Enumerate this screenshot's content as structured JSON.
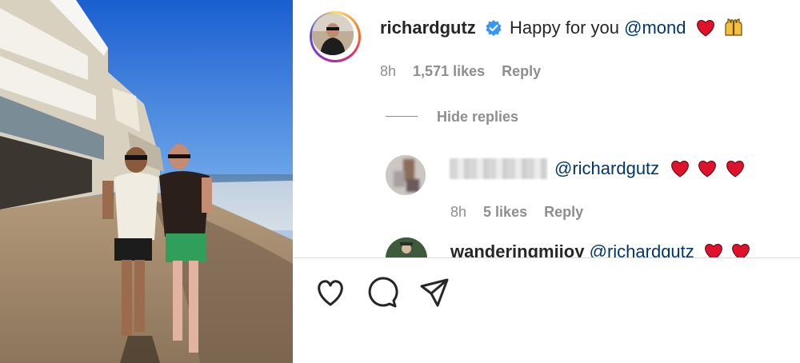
{
  "post": {
    "image_icon": "beach-photo"
  },
  "comment": {
    "username": "richardgutz",
    "verified_icon": "verified-badge-icon",
    "text": "Happy for you",
    "mention": "@mond",
    "emojis": [
      "red-heart",
      "raising-hands"
    ],
    "time": "8h",
    "likes": "1,571 likes",
    "reply_label": "Reply"
  },
  "replies_toggle": "Hide replies",
  "replies": [
    {
      "username_blurred": true,
      "mention": "@richardgutz",
      "emojis": [
        "red-heart",
        "red-heart",
        "red-heart"
      ],
      "time": "8h",
      "likes": "5 likes",
      "reply_label": "Reply"
    },
    {
      "username": "wanderingmijoy",
      "mention": "@richardgutz",
      "emojis": [
        "red-heart",
        "red-heart"
      ]
    }
  ],
  "actions": [
    "like-icon",
    "comment-icon",
    "share-icon"
  ],
  "colors": {
    "accent_link": "#00376b",
    "muted": "#8e8e8e",
    "verified": "#3897f0",
    "heart": "#e0112b"
  }
}
